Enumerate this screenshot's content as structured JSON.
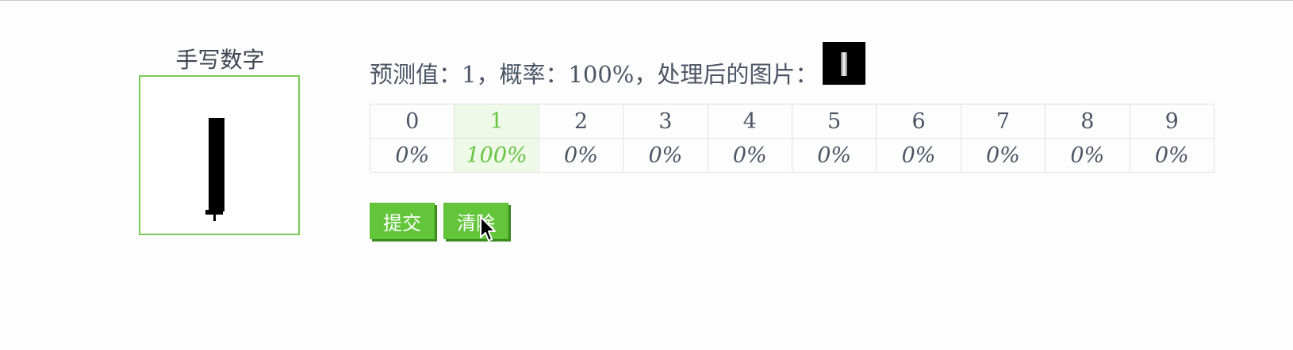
{
  "pad": {
    "title": "手写数字"
  },
  "result": {
    "text": "预测值：1，概率：100%，处理后的图片："
  },
  "probabilities": {
    "digits": [
      "0",
      "1",
      "2",
      "3",
      "4",
      "5",
      "6",
      "7",
      "8",
      "9"
    ],
    "values": [
      "0%",
      "100%",
      "0%",
      "0%",
      "0%",
      "0%",
      "0%",
      "0%",
      "0%",
      "0%"
    ],
    "highlight_index": 1
  },
  "buttons": {
    "submit": "提交",
    "clear": "清除"
  },
  "colors": {
    "accent": "#62c53a",
    "highlight_bg": "#eef9e8",
    "highlight_text": "#66c440",
    "canvas_border": "#7bc95a"
  },
  "icons": {
    "cursor": "arrow-pointer-icon"
  }
}
